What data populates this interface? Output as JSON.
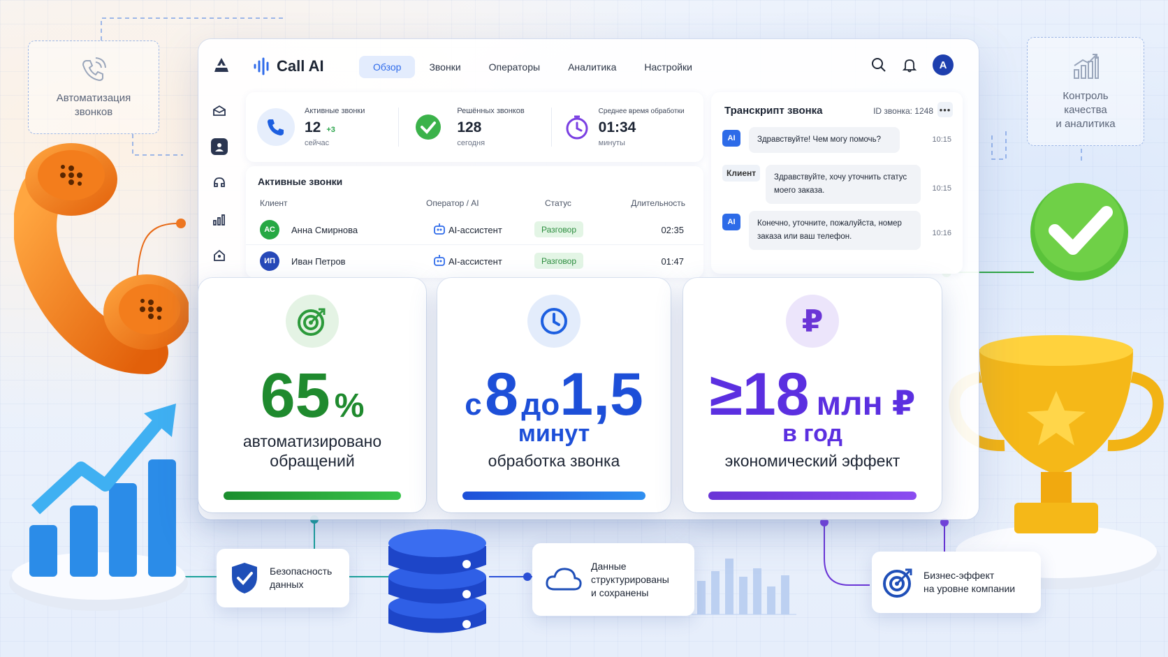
{
  "side_cards": {
    "automation": "Автоматизация\nзвонков",
    "quality": "Контроль\nкачества\nи аналитика"
  },
  "app": {
    "name": "Call AI",
    "tabs": [
      "Обзор",
      "Звонки",
      "Операторы",
      "Аналитика",
      "Настройки"
    ],
    "active_tab": "Обзор",
    "avatar_letter": "A"
  },
  "stats": [
    {
      "label": "Активные звонки",
      "value": "12",
      "delta": "+3",
      "sub": "сейчас"
    },
    {
      "label": "Решённых звонков",
      "value": "128",
      "sub": "сегодня"
    },
    {
      "label": "Среднее время обработки",
      "value": "01:34",
      "sub": "минуты"
    }
  ],
  "active_calls": {
    "title": "Активные звонки",
    "columns": [
      "Клиент",
      "Оператор / AI",
      "Статус",
      "Длительность"
    ],
    "rows": [
      {
        "initials": "АС",
        "client": "Анна Смирнова",
        "operator": "AI-ассистент",
        "status": "Разговор",
        "duration": "02:35",
        "color": "#27a844"
      },
      {
        "initials": "ИП",
        "client": "Иван Петров",
        "operator": "AI-ассистент",
        "status": "Разговор",
        "duration": "01:47",
        "color": "#2648b8"
      }
    ]
  },
  "transcript": {
    "title": "Транскрипт звонка",
    "call_id": "ID звонка: 1248",
    "more": "•••",
    "messages": [
      {
        "speaker": "AI",
        "text": "Здравствуйте! Чем могу помочь?",
        "time": "10:15"
      },
      {
        "speaker": "Клиент",
        "text": "Здравствуйте, хочу уточнить статус моего заказа.",
        "time": "10:15"
      },
      {
        "speaker": "AI",
        "text": "Конечно, уточните, пожалуйста, номер заказа или ваш телефон.",
        "time": "10:16"
      }
    ]
  },
  "metrics": [
    {
      "big": "65",
      "unit": "%",
      "desc_1": "автоматизировано",
      "desc_2": "обращений",
      "progress": 1.0,
      "color": "#1f8a2e"
    },
    {
      "prefix": "с",
      "from": "8",
      "mid": "до",
      "to": "1,5",
      "line2": "минут",
      "desc_1": "обработка звонка",
      "progress": 1.0,
      "color": "#1d4fd8"
    },
    {
      "big": "≥18",
      "unit": "млн ₽",
      "line2": "в год",
      "desc_1": "экономический эффект",
      "progress": 1.0,
      "color": "#5b2fe0"
    }
  ],
  "flow_nodes": {
    "security": "Безопасность\nданных",
    "data": "Данные\nструктурированы\nи сохранены",
    "business": "Бизнес-эффект\nна уровне компании"
  },
  "bg_chart_ticks": [
    "3",
    "3",
    "3",
    "3",
    "3",
    "3",
    "3",
    "10"
  ],
  "colors": {
    "accent": "#2f6bea",
    "green": "#1f8a2e",
    "blue": "#1d4fd8",
    "purple": "#5b2fe0",
    "phone_orange": "#f07a12",
    "trophy_gold": "#f2b314"
  }
}
